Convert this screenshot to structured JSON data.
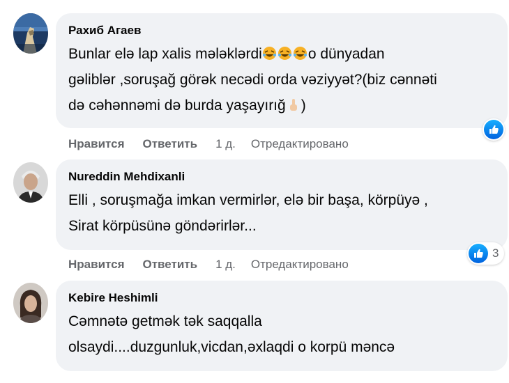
{
  "comments": [
    {
      "author": "Рахиб Агаев",
      "lines": [
        "Bunlar elə lap xalis mələklərdi",
        "o dünyadan",
        "gəliblər ,soruşağ görək necədi orda vəziyyət?(biz cənnəti",
        "də cəhənnəmi də burda yaşayırığ",
        ")"
      ],
      "like_label": "Нравится",
      "reply_label": "Ответить",
      "time": "1 д.",
      "edited": "Отредактировано",
      "reaction_count": ""
    },
    {
      "author": "Nureddin Mehdixanli",
      "lines": [
        "Elli , soruşmağa imkan vermirlər, elə bir başa, körpüyə ,",
        "Sirat körpüsünə göndərirlər..."
      ],
      "like_label": "Нравится",
      "reply_label": "Ответить",
      "time": "1 д.",
      "edited": "Отредактировано",
      "reaction_count": "3"
    },
    {
      "author": "Kebire Heshimli",
      "lines": [
        "Cəmnətə getmək tək saqqalla",
        "olsaydi....duzgunluk,vicdan,əxlaqdi o korpü məncə"
      ]
    }
  ],
  "colors": {
    "bubble": "#f0f2f5",
    "muted": "#65676b",
    "like_blue": "#1877f2"
  },
  "icons": {
    "laugh": "rolling-on-floor-laughing-emoji",
    "hand": "index-pointing-up-emoji",
    "like": "thumbs-up-like-icon"
  }
}
